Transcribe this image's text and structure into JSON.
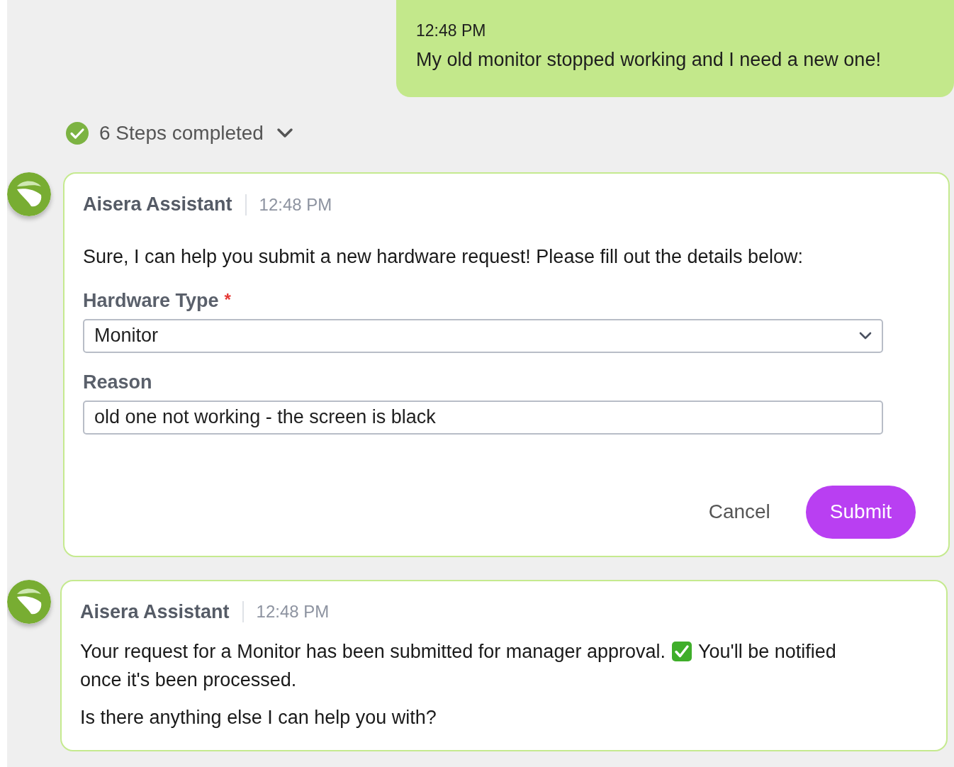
{
  "user_message": {
    "time": "12:48 PM",
    "text": "My old monitor stopped working and I need a new one!"
  },
  "steps": {
    "label": "6 Steps completed",
    "completed": true,
    "expanded": false
  },
  "messages": [
    {
      "kind": "form",
      "sender": "Aisera Assistant",
      "time": "12:48 PM",
      "text": "Sure, I can help you submit a new hardware request! Please fill out the details below:",
      "fields": [
        {
          "kind": "select",
          "label": "Hardware Type",
          "required_marker": "*",
          "value": "Monitor"
        },
        {
          "kind": "text",
          "label": "Reason",
          "value": "old one not working - the screen is black"
        }
      ],
      "buttons": [
        {
          "kind": "secondary",
          "label": "Cancel"
        },
        {
          "kind": "primary",
          "label": "Submit"
        }
      ]
    },
    {
      "kind": "text",
      "sender": "Aisera Assistant",
      "time": "12:48 PM",
      "paragraphs": [
        {
          "lines": [
            {
              "parts": [
                "Your request for a Monitor has been submitted for manager approval.",
                "You'll be notified"
              ]
            },
            {
              "parts": [
                "once it's been processed."
              ]
            }
          ]
        },
        {
          "lines": [
            {
              "parts": [
                "Is there anything else I can help you with?"
              ]
            }
          ]
        }
      ]
    }
  ]
}
